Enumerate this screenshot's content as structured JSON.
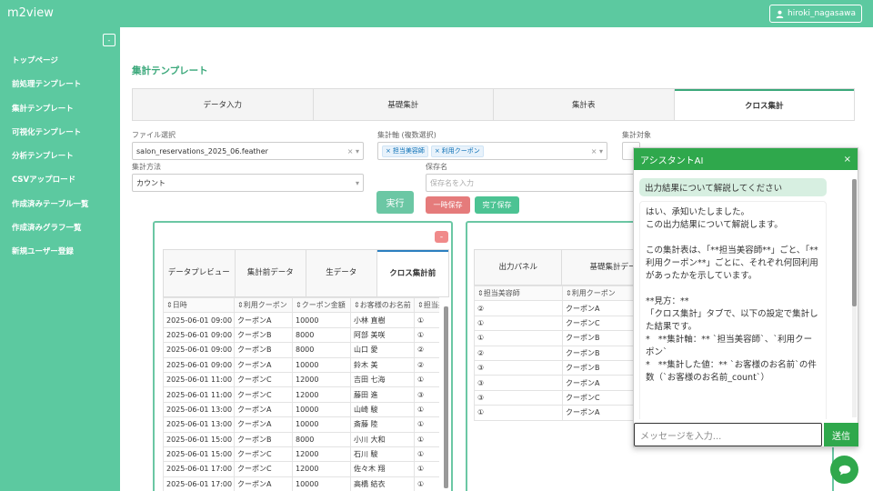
{
  "app": {
    "brand": "m2view",
    "user": "hiroki_nagasawa"
  },
  "sidebar": {
    "collapse_label": "-",
    "items": [
      "トップページ",
      "前処理テンプレート",
      "集計テンプレート",
      "可視化テンプレート",
      "分析テンプレート",
      "CSVアップロード",
      "作成済みテーブル一覧",
      "作成済みグラフ一覧",
      "新規ユーザー登録"
    ]
  },
  "page": {
    "title": "集計テンプレート"
  },
  "tabs": [
    "データ入力",
    "基礎集計",
    "集計表",
    "クロス集計"
  ],
  "form": {
    "file_label": "ファイル選択",
    "file_value": "salon_reservations_2025_06.feather",
    "axis_label": "集計軸 (複数選択)",
    "axis_chips": [
      "担当美容師",
      "利用クーポン"
    ],
    "target_label": "集計対象",
    "method_label": "集計方法",
    "method_value": "カウント",
    "save_label": "保存名",
    "save_placeholder": "保存名を入力",
    "run_label": "実行",
    "temp_save_label": "一時保存",
    "final_save_label": "完了保存"
  },
  "left_panel": {
    "collapse_label": "-",
    "tabs": [
      "データプレビュー",
      "集計前データ",
      "生データ",
      "クロス集計前"
    ],
    "headers": [
      "⇕日時",
      "⇕利用クーポン",
      "⇕クーポン金額",
      "⇕お客様のお名前",
      "⇕担当美容師"
    ],
    "rows": [
      [
        "2025-06-01 09:00",
        "クーポンA",
        "10000",
        "小林 直樹",
        "①"
      ],
      [
        "2025-06-01 09:00",
        "クーポンB",
        "8000",
        "阿部 美咲",
        "①"
      ],
      [
        "2025-06-01 09:00",
        "クーポンB",
        "8000",
        "山口 愛",
        "②"
      ],
      [
        "2025-06-01 09:00",
        "クーポンA",
        "10000",
        "鈴木 美",
        "②"
      ],
      [
        "2025-06-01 11:00",
        "クーポンC",
        "12000",
        "吉田 七海",
        "①"
      ],
      [
        "2025-06-01 11:00",
        "クーポンC",
        "12000",
        "藤田 進",
        "③"
      ],
      [
        "2025-06-01 13:00",
        "クーポンA",
        "10000",
        "山崎 駿",
        "①"
      ],
      [
        "2025-06-01 13:00",
        "クーポンA",
        "10000",
        "斎藤 陸",
        "①"
      ],
      [
        "2025-06-01 15:00",
        "クーポンB",
        "8000",
        "小川 大和",
        "①"
      ],
      [
        "2025-06-01 15:00",
        "クーポンC",
        "12000",
        "石川 駿",
        "①"
      ],
      [
        "2025-06-01 17:00",
        "クーポンC",
        "12000",
        "佐々木 翔",
        "①"
      ],
      [
        "2025-06-01 17:00",
        "クーポンA",
        "10000",
        "高橋 結衣",
        "①"
      ]
    ]
  },
  "right_panel": {
    "tabs": [
      "出力パネル",
      "基礎集計データ"
    ],
    "headers": [
      "⇕担当美容師",
      "⇕利用クーポン"
    ],
    "rows": [
      [
        "②",
        "クーポンA"
      ],
      [
        "①",
        "クーポンC"
      ],
      [
        "①",
        "クーポンB"
      ],
      [
        "②",
        "クーポンB"
      ],
      [
        "③",
        "クーポンB"
      ],
      [
        "③",
        "クーポンA"
      ],
      [
        "③",
        "クーポンC"
      ],
      [
        "①",
        "クーポンA"
      ]
    ]
  },
  "chat": {
    "title": "アシスタントAI",
    "close_label": "×",
    "user_message": "出力結果について解説してください",
    "ai_message": "はい、承知いたしました。\nこの出力結果について解説します。\n\nこの集計表は、「**担当美容師**」ごと、「**利用クーポン**」ごとに、それぞれ何回利用があったかを示しています。\n\n**見方：**\n「クロス集計」タブで、以下の設定で集計した結果です。\n*   **集計軸：** `担当美容師`、`利用クーポン`\n*   **集計した値：** `お客様のお名前`の件数（`お客様のお名前_count`）",
    "input_placeholder": "メッセージを入力...",
    "send_label": "送信"
  },
  "colors": {
    "primary": "#5cc9a0",
    "assistant": "#2fa84c",
    "danger": "#e57b7b",
    "success": "#4cc393"
  }
}
